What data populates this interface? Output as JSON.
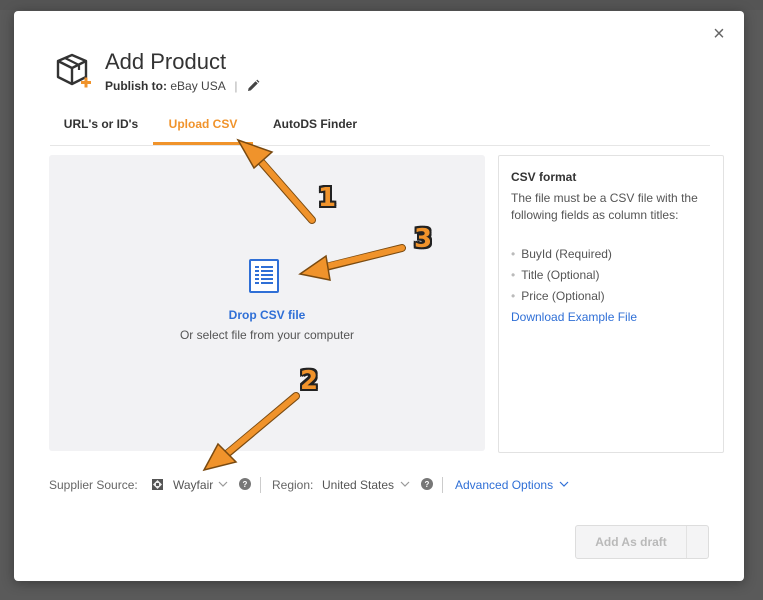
{
  "modal": {
    "title": "Add Product",
    "publish_label": "Publish to:",
    "publish_value": "eBay USA",
    "publish_sep": "|",
    "close_glyph": "×"
  },
  "tabs": [
    {
      "label": "URL's or ID's",
      "active": false
    },
    {
      "label": "Upload CSV",
      "active": true
    },
    {
      "label": "AutoDS Finder",
      "active": false
    }
  ],
  "dropzone": {
    "title": "Drop CSV file",
    "subtitle": "Or select file from your computer",
    "icon": "csv-file-icon"
  },
  "csv_format": {
    "title": "CSV format",
    "description": "The file must be a CSV file with the following fields as column titles:",
    "fields": [
      "BuyId (Required)",
      "Title (Optional)",
      "Price (Optional)"
    ],
    "download_link": "Download Example File"
  },
  "filters": {
    "supplier_label": "Supplier Source:",
    "supplier_value": "Wayfair",
    "region_label": "Region:",
    "region_value": "United States",
    "advanced_label": "Advanced Options"
  },
  "actions": {
    "add_draft_label": "Add As draft"
  },
  "annotations": {
    "step1": "1",
    "step2": "2",
    "step3": "3"
  },
  "colors": {
    "accent": "#f0932b",
    "link": "#2f6fd6"
  }
}
